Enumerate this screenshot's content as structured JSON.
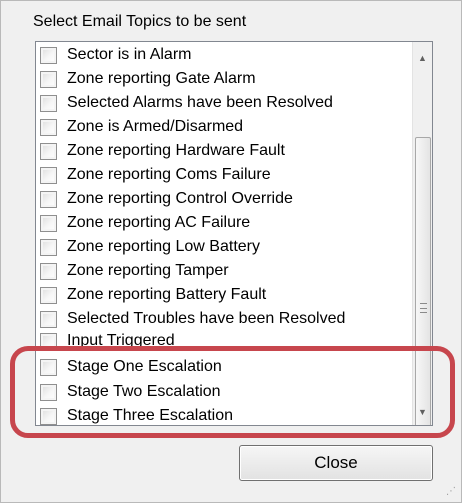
{
  "dialog": {
    "group_label": "Select Email Topics to be sent",
    "close_button_label": "Close"
  },
  "topics": [
    {
      "label": "Sector is in Alarm",
      "checked": false
    },
    {
      "label": "Zone reporting Gate Alarm",
      "checked": false
    },
    {
      "label": "Selected Alarms have been Resolved",
      "checked": false
    },
    {
      "label": "Zone is Armed/Disarmed",
      "checked": false
    },
    {
      "label": "Zone reporting Hardware Fault",
      "checked": false
    },
    {
      "label": "Zone reporting Coms Failure",
      "checked": false
    },
    {
      "label": "Zone reporting Control Override",
      "checked": false
    },
    {
      "label": "Zone reporting AC Failure",
      "checked": false
    },
    {
      "label": "Zone reporting Low Battery",
      "checked": false
    },
    {
      "label": "Zone reporting Tamper",
      "checked": false
    },
    {
      "label": "Zone reporting Battery Fault",
      "checked": false
    },
    {
      "label": "Selected Troubles have been Resolved",
      "checked": false
    },
    {
      "label": "Input Triggered",
      "checked": false
    },
    {
      "label": "Stage One Escalation",
      "checked": false
    },
    {
      "label": "Stage Two Escalation",
      "checked": false
    },
    {
      "label": "Stage Three Escalation",
      "checked": false
    }
  ],
  "icons": {
    "scroll_up": "triangle-up-icon",
    "scroll_down": "triangle-down-icon",
    "scroll_grip": "grip-icon",
    "resize_grip": "resize-grip-icon",
    "checkbox": "checkbox-icon"
  },
  "colors": {
    "highlight": "#c7464d",
    "dialog_background": "#f0f0f0",
    "list_background": "#ffffff"
  }
}
